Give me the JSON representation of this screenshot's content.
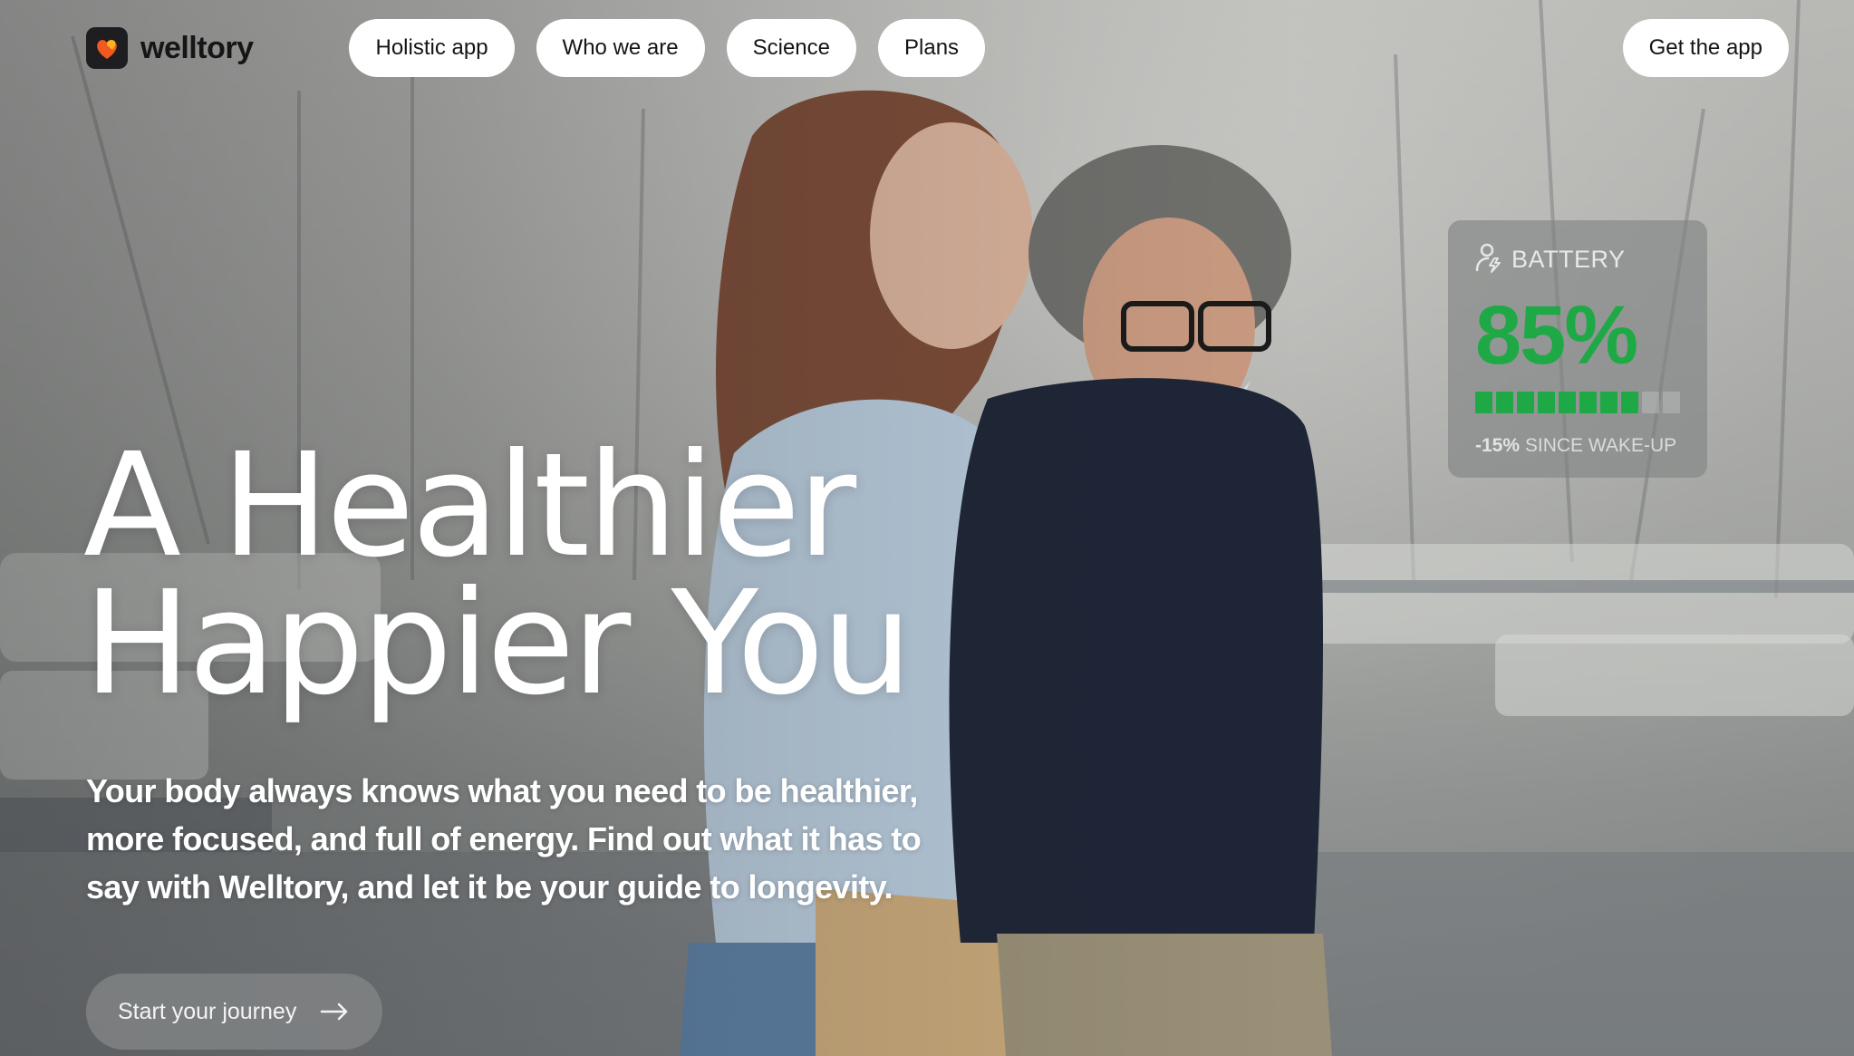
{
  "brand": {
    "name": "welltory"
  },
  "nav": {
    "items": [
      {
        "label": "Holistic app"
      },
      {
        "label": "Who we are"
      },
      {
        "label": "Science"
      },
      {
        "label": "Plans"
      }
    ],
    "cta_label": "Get the app"
  },
  "battery_widget": {
    "label": "BATTERY",
    "value": "85%",
    "level_fraction": 0.8,
    "change": "-15%",
    "change_caption": "SINCE WAKE-UP",
    "accent_color": "#1fa946",
    "icon": "person-bolt-icon"
  },
  "hero": {
    "headline_line1": "A Healthier",
    "headline_line2": "Happier You",
    "subtext": "Your body always knows what you need to be healthier, more focused, and full of energy. Find out what it has to say with Welltory, and let it be your guide to longevity.",
    "cta_label": "Start your journey",
    "cta_icon": "arrow-right-icon"
  },
  "colors": {
    "pill_bg": "#ffffff",
    "text_dark": "#151515",
    "logo_accent": "#f05a1e"
  }
}
